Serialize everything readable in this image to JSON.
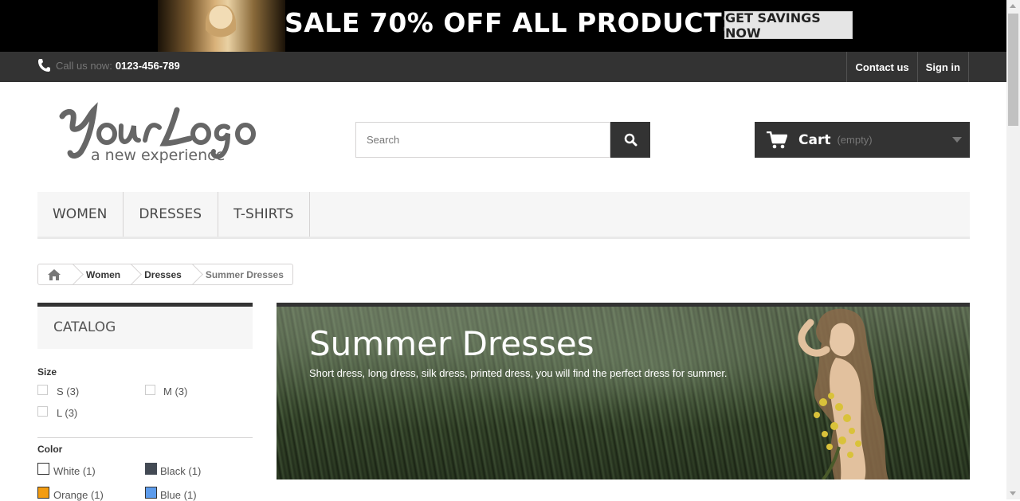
{
  "promo": {
    "text": "SALE 70% OFF ALL PRODUCTS",
    "button_label": "GET SAVINGS NOW"
  },
  "topnav": {
    "phone_label": "Call us now:",
    "phone_number": "0123-456-789",
    "links": [
      "Contact us",
      "Sign in"
    ]
  },
  "header": {
    "search_placeholder": "Search",
    "cart_label": "Cart",
    "cart_status": "(empty)"
  },
  "menu": {
    "items": [
      "WOMEN",
      "DRESSES",
      "T-SHIRTS"
    ]
  },
  "breadcrumb": {
    "items": [
      "Women",
      "Dresses"
    ],
    "current": "Summer Dresses"
  },
  "sidebar": {
    "catalog_title": "CATALOG",
    "size": {
      "title": "Size",
      "options": [
        "S (3)",
        "M (3)",
        "L (3)"
      ]
    },
    "color": {
      "title": "Color",
      "options": [
        {
          "label": "White (1)",
          "color": "#ffffff"
        },
        {
          "label": "Black (1)",
          "color": "#434a54"
        },
        {
          "label": "Orange (1)",
          "color": "#f39c11"
        },
        {
          "label": "Blue (1)",
          "color": "#5d9cec"
        }
      ]
    }
  },
  "category": {
    "title": "Summer Dresses",
    "description": "Short dress, long dress, silk dress, printed dress, you will find the perfect dress for summer."
  }
}
